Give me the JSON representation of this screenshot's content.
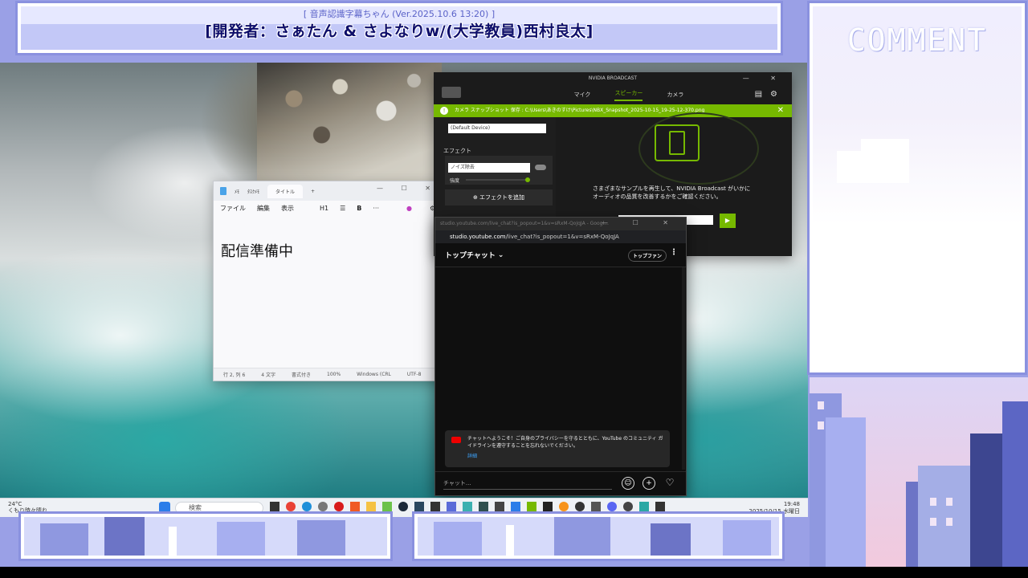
{
  "overlay": {
    "subtitle_tag": "[ 音声認識字幕ちゃん (Ver.2025.10.6 13:20) ]",
    "dev_credit": "[開発者：さぁたん & さよなりw/(大学教員)西村良太]",
    "comment_title": "COMMENT"
  },
  "notepad": {
    "tabs": [
      "ﾒﾓ",
      "ﾀｽｸﾒﾓ",
      "タイトル"
    ],
    "menu": [
      "ファイル",
      "編集",
      "表示"
    ],
    "heading_level": "H1",
    "content": "配信準備中",
    "status": {
      "position": "行 2, 列 6",
      "chars": "4 文字",
      "format": "書式付き",
      "zoom": "100%",
      "line_ending": "Windows (CRL",
      "encoding": "UTF-8"
    }
  },
  "nvidia": {
    "title": "NVIDIA BROADCAST",
    "tabs": [
      "マイク",
      "スピーカー",
      "カメラ"
    ],
    "active_tab": "スピーカー",
    "notice": "カメラ スナップショット 保存 : C:\\Users\\あきのすけ\\Pictures\\NBX_Snapshot_2025-10-15_19-25-12-370.png",
    "device": "(Default Device)",
    "effect_label": "エフェクト",
    "effect_value": "ノイズ除去",
    "strength_label": "強度",
    "add_effect": "エフェクトを追加",
    "description_1": "さまざまなサンプルを再生して、NVIDIA Broadcast がいかに",
    "description_2": "オーディオの品質を改善するかをご確認ください。"
  },
  "ytchat": {
    "title_faded": "studio.youtube.com/live_chat?is_popout=1&v=sRxM-QoJqJA - Googl...",
    "url_host": "studio.youtube.com",
    "url_path": "/live_chat?is_popout=1&v=sRxM-QoJqJA",
    "header": "トップチャット",
    "topfan": "トップファン",
    "welcome": "チャットへようこそ！ご自身のプライバシーを守るとともに、YouTube のコミュニティ ガイドラインを遵守することを忘れないでください。",
    "detail_link": "詳細",
    "input_placeholder": "チャット..."
  },
  "taskbar": {
    "weather_temp": "24°C",
    "weather_desc": "くもり時々晴れ",
    "search_placeholder": "検索",
    "clock_time": "19:48",
    "clock_date": "2025/10/15 水曜日"
  }
}
